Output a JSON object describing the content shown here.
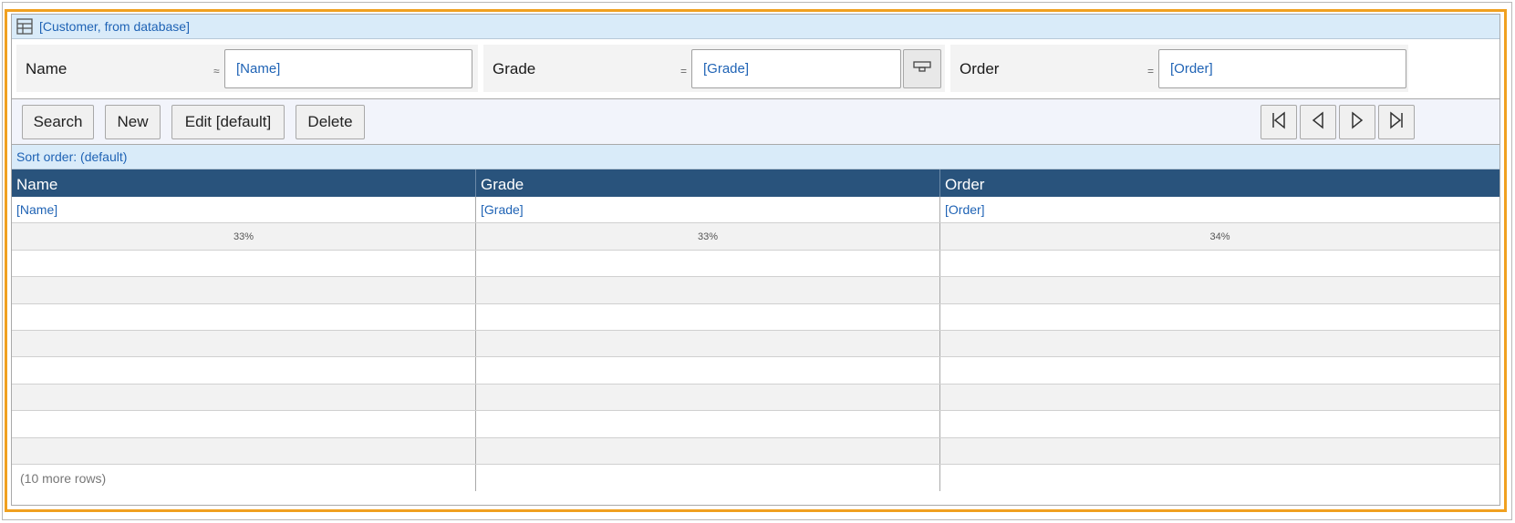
{
  "titlebar": {
    "icon": "table-icon",
    "label": "[Customer, from database]"
  },
  "filters": [
    {
      "label": "Name",
      "operator": "≈",
      "value": "[Name]"
    },
    {
      "label": "Grade",
      "operator": "=",
      "value": "[Grade]",
      "button_icon": "lookup-icon"
    },
    {
      "label": "Order",
      "operator": "=",
      "value": "[Order]"
    }
  ],
  "toolbar": {
    "search": "Search",
    "new": "New",
    "edit": "Edit [default]",
    "delete": "Delete",
    "nav": [
      "first-record-icon",
      "previous-record-icon",
      "next-record-icon",
      "last-record-icon"
    ]
  },
  "sort": {
    "label": "Sort order: (default)"
  },
  "grid": {
    "headers": [
      "Name",
      "Grade",
      "Order"
    ],
    "bindings": [
      "[Name]",
      "[Grade]",
      "[Order]"
    ],
    "widths": [
      "33%",
      "33%",
      "34%"
    ],
    "more_rows": "(10 more rows)"
  },
  "colors": {
    "accent_frame": "#f0a020",
    "header_bg": "#29537c",
    "link_blue": "#1f63b5",
    "title_bg": "#d9ebf9"
  }
}
